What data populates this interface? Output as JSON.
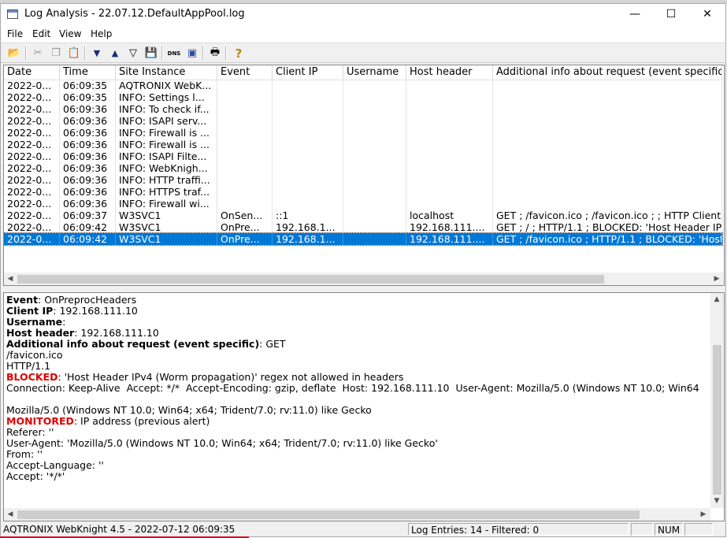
{
  "window": {
    "title": "Log Analysis - 22.07.12.DefaultAppPool.log",
    "minimize": "—",
    "maximize": "☐",
    "close": "✕"
  },
  "menu": [
    "File",
    "Edit",
    "View",
    "Help"
  ],
  "toolbar": [
    {
      "name": "open-icon",
      "glyph": "📂"
    },
    {
      "name": "cut-icon",
      "glyph": "✂"
    },
    {
      "name": "copy-icon",
      "glyph": "❐"
    },
    {
      "name": "paste-icon",
      "glyph": "📋"
    },
    {
      "name": "arrow-down-icon",
      "glyph": "▼"
    },
    {
      "name": "arrow-up-icon",
      "glyph": "▲"
    },
    {
      "name": "filter-icon",
      "glyph": "▽"
    },
    {
      "name": "save-icon",
      "glyph": "💾"
    },
    {
      "name": "dns-icon",
      "glyph": "DNS"
    },
    {
      "name": "details-icon",
      "glyph": "▣"
    },
    {
      "name": "print-icon",
      "glyph": "🖶"
    },
    {
      "name": "help-icon",
      "glyph": "?"
    }
  ],
  "columns": [
    "Date",
    "Time",
    "Site Instance",
    "Event",
    "Client IP",
    "Username",
    "Host header",
    "Additional info about request (event specific)"
  ],
  "rows": [
    [
      "2022-0...",
      "06:09:35",
      "AQTRONIX WebK...",
      "",
      "",
      "",
      "",
      ""
    ],
    [
      "2022-0...",
      "06:09:35",
      "INFO: Settings l...",
      "",
      "",
      "",
      "",
      ""
    ],
    [
      "2022-0...",
      "06:09:36",
      "INFO: To check if...",
      "",
      "",
      "",
      "",
      ""
    ],
    [
      "2022-0...",
      "06:09:36",
      "INFO: ISAPI serv...",
      "",
      "",
      "",
      "",
      ""
    ],
    [
      "2022-0...",
      "06:09:36",
      "INFO: Firewall is ...",
      "",
      "",
      "",
      "",
      ""
    ],
    [
      "2022-0...",
      "06:09:36",
      "INFO: Firewall is ...",
      "",
      "",
      "",
      "",
      ""
    ],
    [
      "2022-0...",
      "06:09:36",
      "INFO: ISAPI Filte...",
      "",
      "",
      "",
      "",
      ""
    ],
    [
      "2022-0...",
      "06:09:36",
      "INFO: WebKnigh...",
      "",
      "",
      "",
      "",
      ""
    ],
    [
      "2022-0...",
      "06:09:36",
      "INFO: HTTP traffi...",
      "",
      "",
      "",
      "",
      ""
    ],
    [
      "2022-0...",
      "06:09:36",
      "INFO: HTTPS traf...",
      "",
      "",
      "",
      "",
      ""
    ],
    [
      "2022-0...",
      "06:09:36",
      "INFO: Firewall wi...",
      "",
      "",
      "",
      "",
      ""
    ],
    [
      "2022-0...",
      "06:09:37",
      "W3SVC1",
      "OnSen...",
      "::1",
      "",
      "localhost",
      "GET ; /favicon.ico ; /favicon.ico ;  ; HTTP Client"
    ],
    [
      "2022-0...",
      "06:09:42",
      "W3SVC1",
      "OnPre...",
      "192.168.1...",
      "",
      "192.168.111....",
      "GET ; / ; HTTP/1.1 ; BLOCKED: 'Host Header IP"
    ],
    [
      "2022-0...",
      "06:09:42",
      "W3SVC1",
      "OnPre...",
      "192.168.1...",
      "",
      "192.168.111....",
      "GET ; /favicon.ico ; HTTP/1.1 ; BLOCKED: 'Host"
    ]
  ],
  "selected_row": 13,
  "detail": {
    "event_label": "Event",
    "event_value": ": OnPreprocHeaders",
    "client_ip_label": "Client IP",
    "client_ip_value": ": 192.168.111.10",
    "username_label": "Username",
    "username_value": ":",
    "host_header_label": "Host header",
    "host_header_value": ": 192.168.111.10",
    "additional_label": "Additional info about request (event specific)",
    "additional_value": ": GET",
    "line_path": "/favicon.ico",
    "line_proto": "HTTP/1.1",
    "blocked_label": "BLOCKED",
    "blocked_value": ": 'Host Header IPv4 (Worm propagation)' regex not allowed in headers",
    "connection_line": "Connection: Keep-Alive  Accept: */*  Accept-Encoding: gzip, deflate  Host: 192.168.111.10  User-Agent: Mozilla/5.0 (Windows NT 10.0; Win64",
    "blank_line": "",
    "ua_line": "Mozilla/5.0 (Windows NT 10.0; Win64; x64; Trident/7.0; rv:11.0) like Gecko",
    "monitored_label": "MONITORED",
    "monitored_value": ": IP address (previous alert)",
    "referer_line": "Referer: ''",
    "user_agent_line": "User-Agent: 'Mozilla/5.0 (Windows NT 10.0; Win64; x64; Trident/7.0; rv:11.0) like Gecko'",
    "from_line": "From: ''",
    "accept_language_line": "Accept-Language: ''",
    "accept_line": "Accept: '*/*'"
  },
  "status": {
    "app": "AQTRONIX WebKnight 4.5 - 2022-07-12 06:09:35",
    "entries": "Log Entries: 14 - Filtered: 0",
    "num": "NUM"
  },
  "colors": {
    "selection": "#0078d7",
    "alert": "#e00000"
  }
}
